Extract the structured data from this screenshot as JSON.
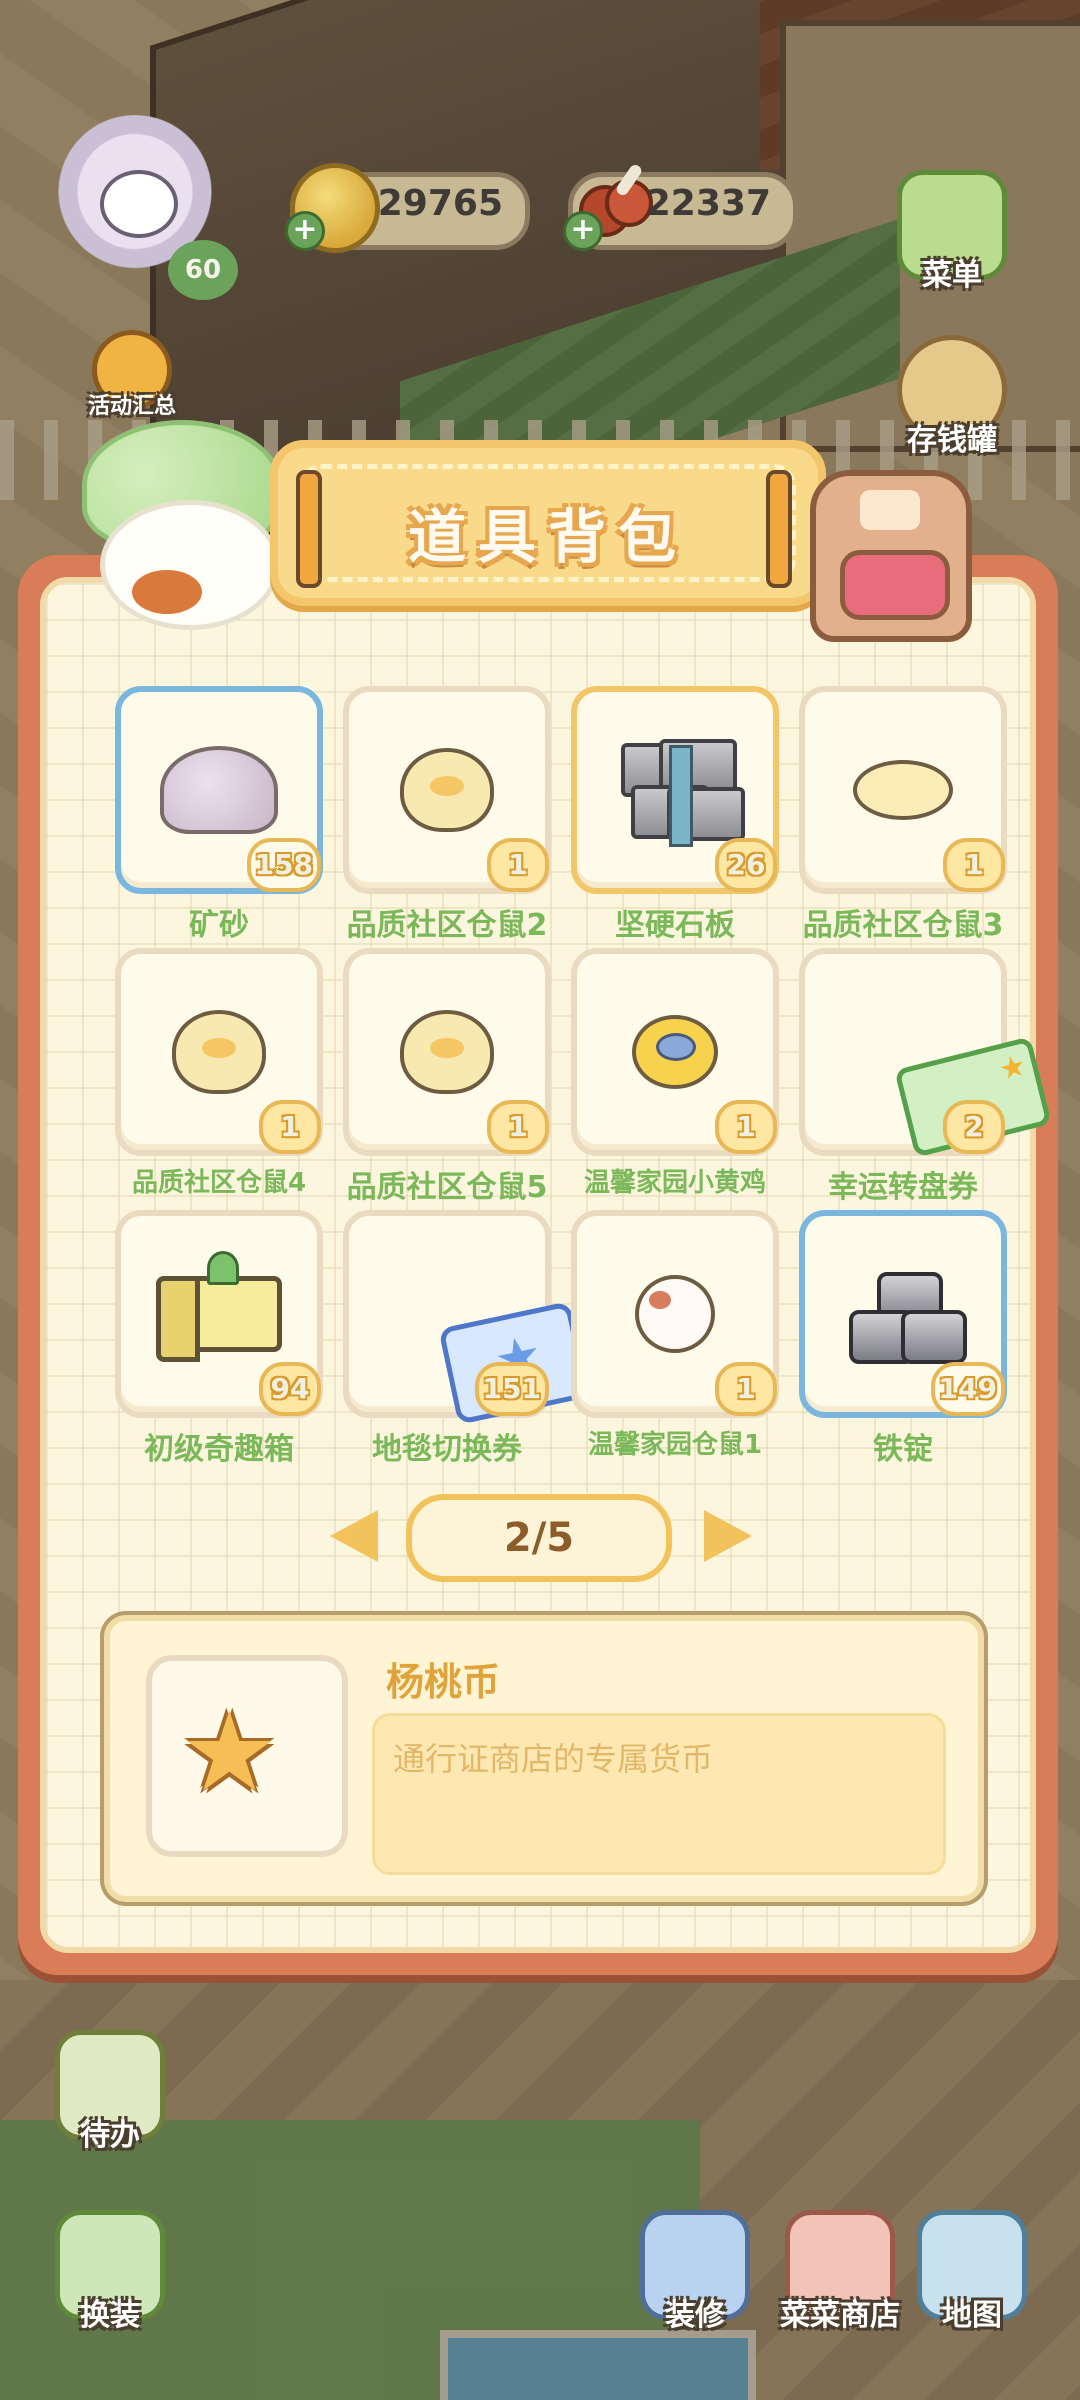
{
  "hud": {
    "level": "60",
    "coins": "29765",
    "meat": "22337",
    "menu_label": "菜单",
    "events_label": "活动汇总",
    "piggybank_label": "存钱罐"
  },
  "panel": {
    "title": "道具背包"
  },
  "items": [
    {
      "name": "矿砂",
      "count": "158"
    },
    {
      "name": "品质社区仓鼠2",
      "count": "1"
    },
    {
      "name": "坚硬石板",
      "count": "26"
    },
    {
      "name": "品质社区仓鼠3",
      "count": "1"
    },
    {
      "name": "品质社区仓鼠4",
      "count": "1"
    },
    {
      "name": "品质社区仓鼠5",
      "count": "1"
    },
    {
      "name": "温馨家园小黄鸡",
      "count": "1"
    },
    {
      "name": "幸运转盘券",
      "count": "2"
    },
    {
      "name": "初级奇趣箱",
      "count": "94"
    },
    {
      "name": "地毯切换券",
      "count": "151"
    },
    {
      "name": "温馨家园仓鼠1",
      "count": "1"
    },
    {
      "name": "铁锭",
      "count": "149"
    }
  ],
  "pager": {
    "text": "2/5"
  },
  "detail": {
    "name": "杨桃币",
    "description": "通行证商店的专属货币"
  },
  "bottom_nav": {
    "todo": "待办",
    "dressup": "换装",
    "decorate": "装修",
    "shop": "菜菜商店",
    "map": "地图"
  },
  "colors": {
    "panel_frame": "#d87d58",
    "panel_bg": "#fdf6df",
    "item_name": "#7ab85a",
    "count_badge": "#e7b855",
    "selected_blue": "#7ab6de"
  }
}
